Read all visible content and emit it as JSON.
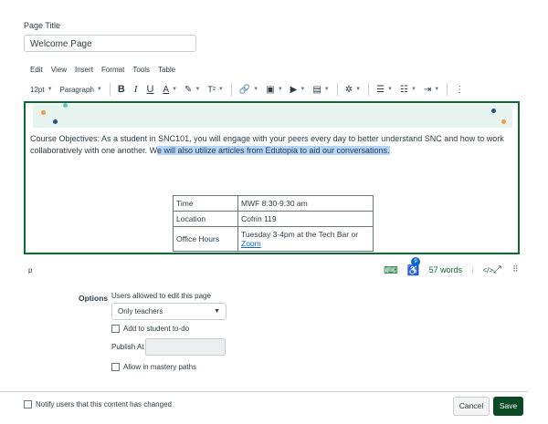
{
  "page_title_label": "Page Title",
  "title_value": "Welcome Page",
  "menu": [
    "Edit",
    "View",
    "Insert",
    "Format",
    "Tools",
    "Table"
  ],
  "toolbar": {
    "font_size": "12pt",
    "block": "Paragraph",
    "bold": "B",
    "italic": "I",
    "underline": "U",
    "font_color": "A",
    "superscript": "T²"
  },
  "editor": {
    "paragraph_before": "Course Objectives: As a student in SNC101, you will engage with your peers every day to better understand SNC and how to work collaboratively with one another. ",
    "paragraph_prefix": "W",
    "paragraph_highlight": "e will also utilize articles from Edutopia to aid our conversations.",
    "table": [
      {
        "key": "Time",
        "value": "MWF 8:30-9:30 am"
      },
      {
        "key": "Location",
        "value": "Cofrin 119"
      },
      {
        "key": "Office Hours",
        "value": "Tuesday 3-4pm at the Tech Bar or ",
        "link": "Zoom"
      }
    ]
  },
  "status": {
    "path": "p",
    "a11y_count": "9",
    "word_count": "57 words",
    "html_toggle": "</>"
  },
  "options": {
    "label": "Options",
    "users_label": "Users allowed to edit this page",
    "users_selected": "Only teachers",
    "todo_label": "Add to student to-do",
    "publish_label": "Publish At",
    "mastery_label": "Allow in mastery paths"
  },
  "footer": {
    "notify_label": "Notify users that this content has changed",
    "cancel": "Cancel",
    "save": "Save"
  },
  "colors": {
    "accent": "#0b6b2e",
    "save_bg": "#0b4a25",
    "highlight": "#b3d4fc",
    "link": "#0b6bc4",
    "banner": "#e6f4ef"
  }
}
